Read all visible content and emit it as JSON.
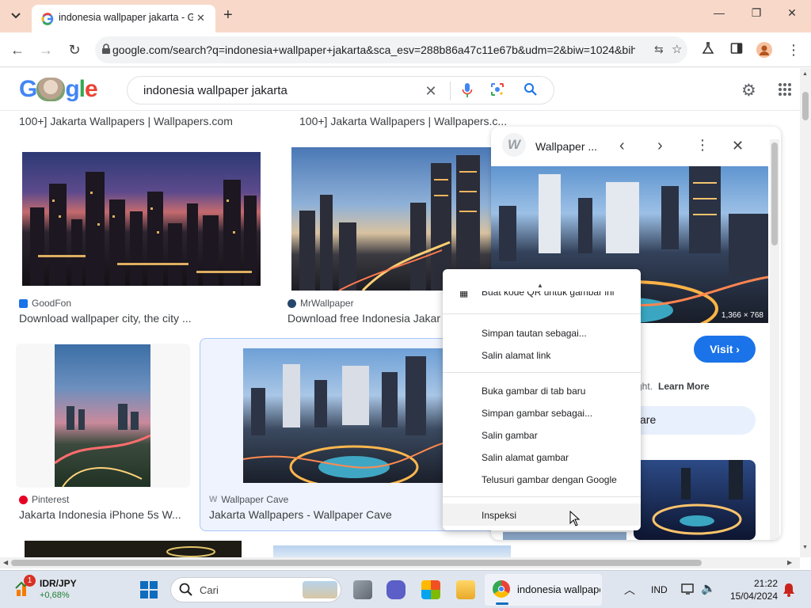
{
  "browser": {
    "tab_title": "indonesia wallpaper jakarta - G",
    "new_tab_symbol": "+",
    "url": "google.com/search?q=indonesia+wallpaper+jakarta&sca_esv=288b86a47c11e67b&udm=2&biw=1024&bih..."
  },
  "search": {
    "query": "indonesia wallpaper jakarta"
  },
  "results": {
    "top_row": [
      {
        "title": "100+] Jakarta Wallpapers | Wallpapers.com"
      },
      {
        "title": "100+] Jakarta Wallpapers | Wallpapers.c..."
      }
    ],
    "row2": [
      {
        "source": "GoodFon",
        "title": "Download wallpaper city, the city ..."
      },
      {
        "source": "MrWallpaper",
        "title": "Download free Indonesia Jakar"
      }
    ],
    "row3": [
      {
        "source": "Pinterest",
        "title": "Jakarta Indonesia iPhone 5s W..."
      },
      {
        "source": "Wallpaper Cave",
        "title": "Jakarta Wallpapers - Wallpaper Cave"
      }
    ]
  },
  "panel": {
    "site_name": "Wallpaper ...",
    "image_size": "1,366 × 768",
    "visit_label": "Visit",
    "copyright_fragment": "ght.",
    "learn_more": "Learn More",
    "share_fragment": "are"
  },
  "context_menu": {
    "partial_top": "Buat kode QR untuk gambar ini",
    "items_group1": [
      "Simpan tautan sebagai...",
      "Salin alamat link"
    ],
    "items_group2": [
      "Buka gambar di tab baru",
      "Simpan gambar sebagai...",
      "Salin gambar",
      "Salin alamat gambar",
      "Telusuri gambar dengan Google"
    ],
    "items_group3": [
      "Inspeksi"
    ]
  },
  "taskbar": {
    "widget_badge": "1",
    "widget_title": "IDR/JPY",
    "widget_value": "+0,68%",
    "search_placeholder": "Cari",
    "active_app_label": "indonesia wallpape",
    "language": "IND",
    "time": "21:22",
    "date": "15/04/2024"
  }
}
